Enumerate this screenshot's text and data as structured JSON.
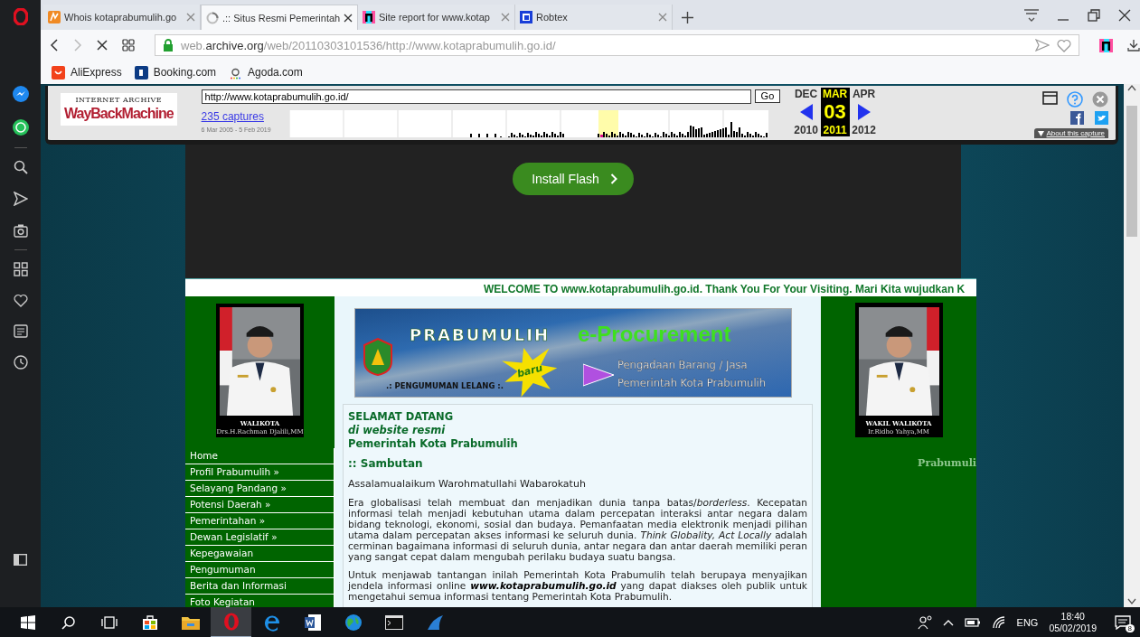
{
  "tabs": [
    {
      "title": "Whois kotaprabumulih.go",
      "selected": false,
      "loading": false
    },
    {
      "title": ".:: Situs Resmi Pemerintah",
      "selected": true,
      "loading": true
    },
    {
      "title": "Site report for www.kotap",
      "selected": false,
      "loading": false
    },
    {
      "title": "Robtex",
      "selected": false,
      "loading": false
    }
  ],
  "address": {
    "prefix": "web.",
    "domain": "archive.org",
    "path": "/web/20110303101536/http://www.kotaprabumulih.go.id/"
  },
  "bookmarks": [
    "AliExpress",
    "Booking.com",
    "Agoda.com"
  ],
  "wayback": {
    "logo_top": "INTERNET ARCHIVE",
    "logo": "WayBackMachine",
    "url": "http://www.kotaprabumulih.go.id/",
    "go": "Go",
    "captures": "235 captures",
    "range": "6 Mar 2005 - 5 Feb 2019",
    "months": [
      {
        "month": "DEC",
        "year": "2010",
        "selected": false
      },
      {
        "month": "MAR",
        "day": "03",
        "year": "2011",
        "selected": true
      },
      {
        "month": "APR",
        "year": "2012",
        "selected": false
      }
    ],
    "about": "About this capture"
  },
  "flash_button": "Install Flash",
  "marquee": "WELCOME TO www.kotaprabumulih.go.id. Thank You For Your Visiting. Mari Kita wujudkan K",
  "left": {
    "caption": "WALIKOTA",
    "name": "Drs.H.Rachman Djalili,MM",
    "menu": [
      "Home",
      "Profil Prabumulih »",
      "Selayang Pandang »",
      "Potensi Daerah »",
      "Pemerintahan »",
      "Dewan Legislatif »",
      "Kepegawaian",
      "Pengumuman",
      "Berita dan Informasi",
      "Foto Kegiatan"
    ]
  },
  "banner": {
    "title": "PRABUMULIH",
    "title_accent": "e-Procurement",
    "badge": "baru",
    "notice": ".: PENGUMUMAN LELANG :.",
    "line_1": "Pengadaan Barang / Jasa",
    "line_2": "Pemerintah Kota Prabumulih"
  },
  "welcome": {
    "line_1": "SELAMAT DATANG",
    "line_2": "di website resmi",
    "line_3": "Pemerintah Kota Prabumulih",
    "heading": ":: Sambutan",
    "greeting": "Assalamualaikum Warohmatullahi Wabarokatuh",
    "paragraphs": [
      "Era globalisasi telah membuat dan menjadikan dunia tanpa batas/*borderless*. Kecepatan informasi telah menjadi kebutuhan utama dalam percepatan interaksi antar negara dalam bidang teknologi, ekonomi, sosial dan budaya. Pemanfaatan media elektronik menjadi pilihan utama dalam percepatan akses informasi ke seluruh dunia. *Think Globality, Act Locally* adalah cerminan bagaimana informasi di seluruh dunia, antar negara dan antar daerah memiliki peran yang sangat cepat dalam mengubah perilaku budaya suatu bangsa.",
      "Untuk menjawab tantangan inilah Pemerintah Kota Prabumulih telah berupaya menyajikan jendela informasi online **www.kotaprabumulih.go.id** yang dapat diakses oleh publik untuk mengetahui semua informasi tentang Pemerintah Kota Prabumulih."
    ]
  },
  "right": {
    "caption": "WAKIL WALIKOTA",
    "name": "Ir.Ridho Yahya,MM",
    "faded_text": "Prabumuli"
  },
  "tray": {
    "language": "ENG",
    "time": "18:40",
    "date": "05/02/2019",
    "notifications": "8"
  }
}
